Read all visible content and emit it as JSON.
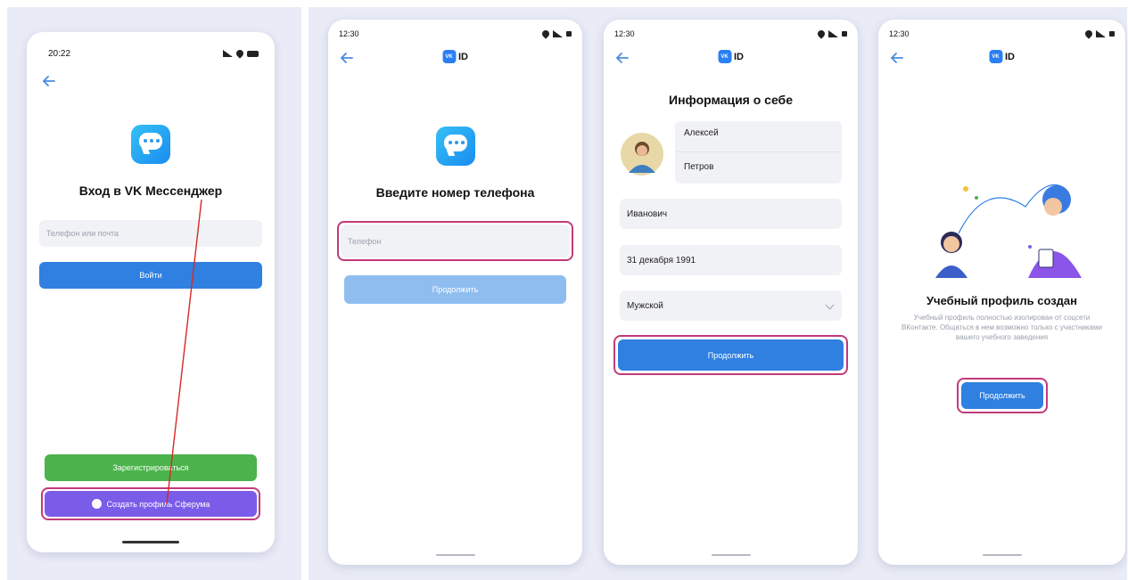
{
  "screen1": {
    "time": "20:22",
    "title": "Вход в VK Мессенджер",
    "login_placeholder": "Телефон или почта",
    "login_button": "Войти",
    "register_button": "Зарегистрироваться",
    "sferum_button": "Создать профиль Сферума"
  },
  "screen2": {
    "time": "12:30",
    "vkid": "ID",
    "title": "Введите номер телефона",
    "phone_placeholder": "Телефон",
    "continue_button": "Продолжить"
  },
  "screen3": {
    "time": "12:30",
    "vkid": "ID",
    "title": "Информация о себе",
    "first_name": "Алексей",
    "last_name": "Петров",
    "patronymic": "Иванович",
    "birth_date": "31 декабря 1991",
    "gender": "Мужской",
    "continue_button": "Продолжить"
  },
  "screen4": {
    "time": "12:30",
    "vkid": "ID",
    "title": "Учебный профиль создан",
    "description": "Учебный профиль полностью изолирован от соцсети ВКонтакте. Общаться в нем возможно только с участниками вашего учебного заведения",
    "continue_button": "Продолжить"
  },
  "colors": {
    "accent_blue": "#2f80e0",
    "green": "#4bb34b",
    "purple": "#7b5ce8",
    "highlight": "#c23a7b",
    "annotation_line": "#d62828"
  }
}
